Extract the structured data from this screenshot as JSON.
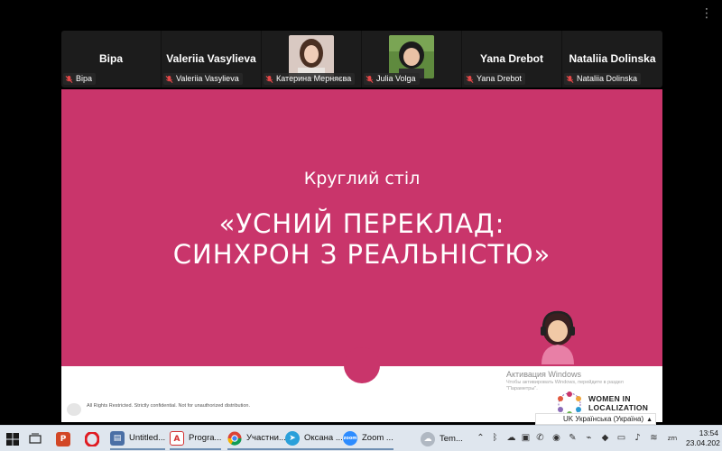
{
  "window": {
    "menu_glyph": "⋮"
  },
  "participants": [
    {
      "display_name": "Віра",
      "label": "Віра",
      "has_video": false
    },
    {
      "display_name": "Valeriia Vasylieva",
      "label": "Valeriia Vasylieva",
      "has_video": false
    },
    {
      "display_name": "",
      "label": "Катерина Мерняєва",
      "has_video": true
    },
    {
      "display_name": "",
      "label": "Julia Volga",
      "has_video": true
    },
    {
      "display_name": "Yana Drebot",
      "label": "Yana Drebot",
      "has_video": false
    },
    {
      "display_name": "Nataliia Dolinska",
      "label": "Nataliia Dolinska",
      "has_video": false
    }
  ],
  "slide": {
    "heading": "Круглий стіл",
    "title_line1": "«УСНИЙ ПЕРЕКЛАД:",
    "title_line2": "СИНХРОН З РЕАЛЬНІСТЮ»",
    "copyright": "All Rights Restricted. Strictly confidential. Not for unauthorized distribution.",
    "brand_line1": "WOMEN IN",
    "brand_line2": "LOCALIZATION",
    "background_color": "#c9356b"
  },
  "activation": {
    "title": "Активация Windows",
    "subtitle": "Чтобы активировать Windows, перейдите в раздел \"Параметры\"."
  },
  "language": {
    "current": "UK Українська (Україна)"
  },
  "taskbar": {
    "apps": [
      {
        "label": "Untitled...",
        "icon": "document-app-icon"
      },
      {
        "label": "Progra...",
        "icon": "pdf-icon"
      },
      {
        "label": "Участни...",
        "icon": "chrome-icon"
      },
      {
        "label": "Оксана ...",
        "icon": "telegram-icon"
      },
      {
        "label": "Zoom ...",
        "icon": "zoom-icon"
      },
      {
        "label": "Tem...",
        "icon": "weather-icon"
      }
    ],
    "time": "13:54",
    "date": "23.04.202"
  }
}
